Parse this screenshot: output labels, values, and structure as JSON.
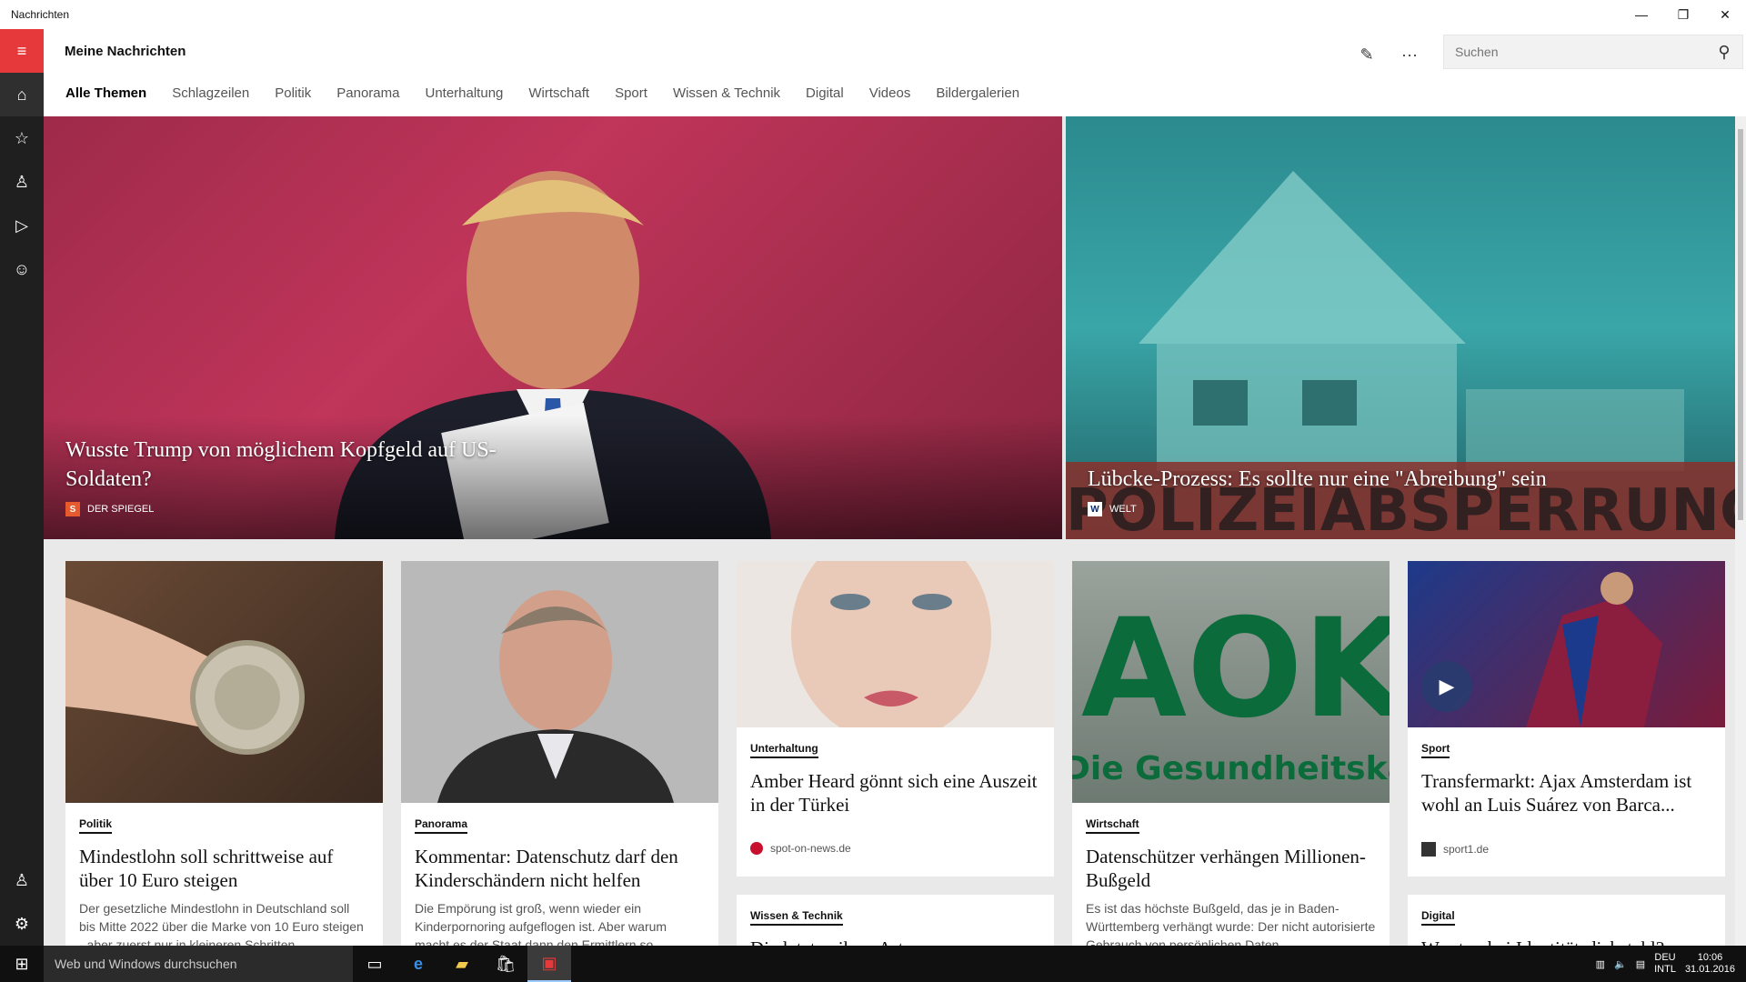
{
  "window": {
    "title": "Nachrichten",
    "minimize": "—",
    "restore": "❐",
    "close": "✕"
  },
  "sidebar": {
    "menu_icon": "≡",
    "items": [
      {
        "name": "home",
        "glyph": "⌂"
      },
      {
        "name": "favorites",
        "glyph": "☆"
      },
      {
        "name": "local",
        "glyph": "♙"
      },
      {
        "name": "video",
        "glyph": "▷"
      },
      {
        "name": "interests",
        "glyph": "☺"
      }
    ],
    "account_glyph": "♙",
    "settings_glyph": "⚙"
  },
  "header": {
    "title": "Meine Nachrichten",
    "edit_glyph": "✎",
    "more_glyph": "···",
    "search_placeholder": "Suchen",
    "search_glyph": "⚲"
  },
  "tabs": [
    "Alle Themen",
    "Schlagzeilen",
    "Politik",
    "Panorama",
    "Unterhaltung",
    "Wirtschaft",
    "Sport",
    "Wissen & Technik",
    "Digital",
    "Videos",
    "Bildergalerien"
  ],
  "hero": [
    {
      "headline": "Wusste Trump von möglichem Kopfgeld auf US-Soldaten?",
      "source": "DER SPIEGEL",
      "badge": "S",
      "badge_color": "#e65a2d"
    },
    {
      "headline": "Lübcke-Prozess:  Es sollte nur eine \"Abreibung\" sein",
      "source": "WELT",
      "badge": "W",
      "badge_color": "#ffffff"
    }
  ],
  "cards": [
    {
      "category": "Politik",
      "title": "Mindestlohn soll schrittweise auf über 10 Euro steigen",
      "snippet": "Der gesetzliche Mindestlohn in Deutschland soll bis Mitte 2022 über die Marke von 10 Euro steigen - aber zuerst nur in kleineren Schritten."
    },
    {
      "category": "Panorama",
      "title": "Kommentar: Datenschutz darf den Kinderschändern nicht helfen",
      "snippet": "Die Empörung ist groß, wenn wieder ein Kinderpornoring aufgeflogen ist. Aber warum macht es der Staat dann den Ermittlern so"
    },
    {
      "category": "Unterhaltung",
      "title": "Amber Heard gönnt sich eine Auszeit in der Türkei",
      "source": "spot-on-news.de"
    },
    {
      "category": "Wirtschaft",
      "title": "Datenschützer verhängen Millionen-Bußgeld",
      "snippet": "Es ist das höchste Bußgeld, das je in Baden-Württemberg verhängt wurde: Der nicht autorisierte Gebrauch von persönlichen Daten"
    },
    {
      "category": "Sport",
      "title": "Transfermarkt: Ajax Amsterdam ist wohl an Luis Suárez von Barca...",
      "source": "sport1.de"
    },
    {
      "category": "Wissen & Technik",
      "title": "Die letzten ihrer Art"
    },
    {
      "category": "Digital",
      "title": "Was tun bei Identitätsdiebstahl?"
    }
  ],
  "aok_sign": {
    "letters": "AOK",
    "text": "Die Gesundheitskasse."
  },
  "police_tape": "POLIZEIABSPERRUNG",
  "taskbar": {
    "start_glyph": "⊞",
    "search_text": "Web und Windows durchsuchen",
    "lang_top": "DEU",
    "lang_bottom": "INTL",
    "time": "10:06",
    "date": "31.01.2016"
  },
  "colors": {
    "accent": "#e6393b",
    "sidebar": "#1f1f1f"
  }
}
